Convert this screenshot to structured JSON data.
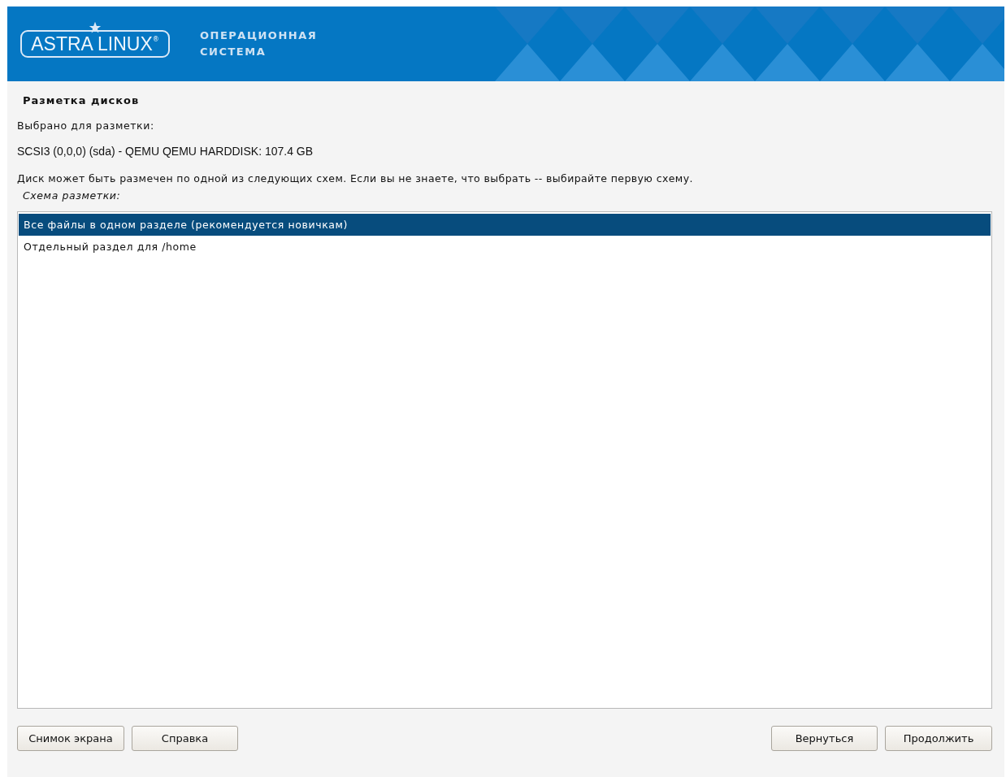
{
  "header": {
    "logo": "ASTRA LINUX",
    "logo_mark": "®",
    "subtitle": [
      "ОПЕРАЦИОННАЯ",
      "СИСТЕМА"
    ]
  },
  "title": "Разметка дисков",
  "selected_label": "Выбрано для разметки:",
  "disk": "SCSI3 (0,0,0) (sda) - QEMU QEMU HARDDISK: 107.4 GB",
  "description": "Диск может быть размечен по одной из следующих схем. Если вы не знаете, что выбрать -- выбирайте первую схему.",
  "list_label": "Схема разметки:",
  "options": [
    {
      "label": "Все файлы в одном разделе (рекомендуется новичкам)",
      "selected": true
    },
    {
      "label": "Отдельный раздел для /home",
      "selected": false
    }
  ],
  "buttons_left": [
    "Снимок экрана",
    "Справка"
  ],
  "buttons_right": [
    "Вернуться",
    "Продолжить"
  ]
}
